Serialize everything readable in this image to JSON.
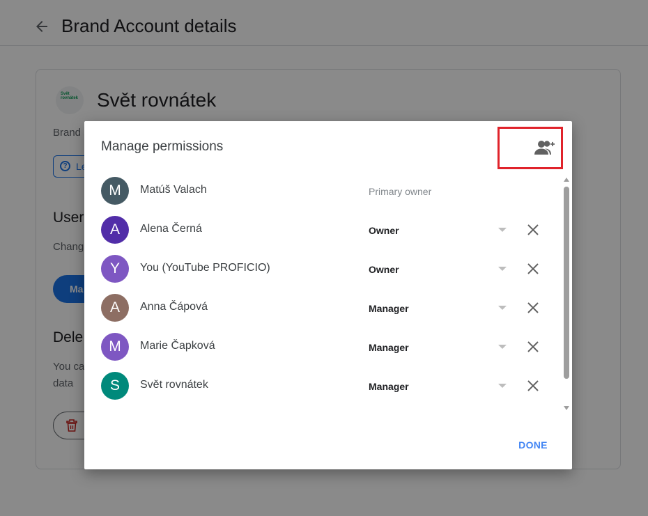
{
  "header": {
    "title": "Brand Account details",
    "back_icon": "arrow-back-icon"
  },
  "brand": {
    "name": "Svět rovnátek",
    "logo_text": "Svět rovnátek",
    "brand_label_partial": "Brand",
    "learn_more_partial": "Le"
  },
  "sections": {
    "users_heading_partial": "User",
    "users_text_partial": "Chang",
    "manage_button_partial": "Ma",
    "delete_heading_partial": "Dele",
    "delete_text_partial_1": "You ca",
    "delete_text_partial_2": "data"
  },
  "dialog": {
    "title": "Manage permissions",
    "add_icon": "person-add-icon",
    "done_label": "DONE",
    "people": [
      {
        "initial": "M",
        "name": "Matúš Valach",
        "role": "Primary owner",
        "avatar_color": "#455a64"
      },
      {
        "initial": "A",
        "name": "Alena Černá",
        "role": "Owner",
        "avatar_color": "#512da8"
      },
      {
        "initial": "Y",
        "name": "You (YouTube PROFICIO)",
        "role": "Owner",
        "avatar_color": "#7e57c2"
      },
      {
        "initial": "A",
        "name": "Anna Čápová",
        "role": "Manager",
        "avatar_color": "#8d6e63"
      },
      {
        "initial": "M",
        "name": "Marie Čapková",
        "role": "Manager",
        "avatar_color": "#7e57c2"
      },
      {
        "initial": "S",
        "name": "Svět rovnátek",
        "role": "Manager",
        "avatar_color": "#00897b"
      }
    ]
  },
  "colors": {
    "accent": "#1a73e8",
    "done_text": "#4285f4",
    "highlight": "#e0232b"
  }
}
